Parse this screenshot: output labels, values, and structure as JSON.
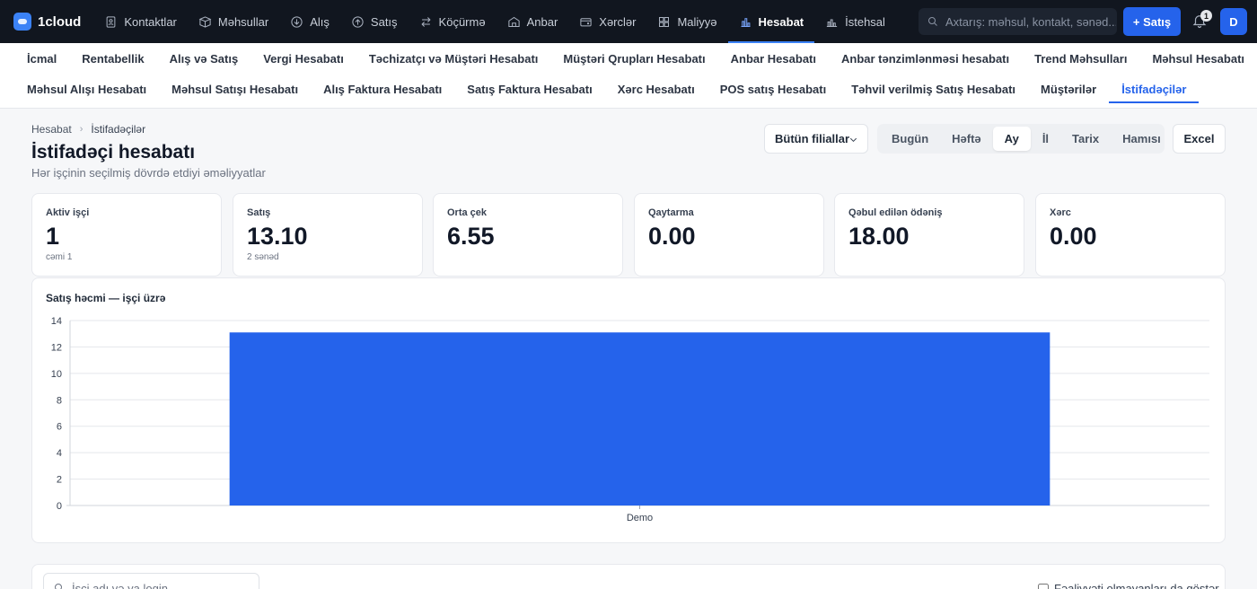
{
  "brand": {
    "name": "1cloud"
  },
  "topnav": [
    {
      "label": "Kontaktlar",
      "icon": "contacts-icon"
    },
    {
      "label": "Məhsullar",
      "icon": "box-icon"
    },
    {
      "label": "Alış",
      "icon": "arrow-down-circle-icon"
    },
    {
      "label": "Satış",
      "icon": "arrow-up-circle-icon"
    },
    {
      "label": "Köçürmə",
      "icon": "transfer-icon"
    },
    {
      "label": "Anbar",
      "icon": "warehouse-icon"
    },
    {
      "label": "Xərclər",
      "icon": "wallet-icon"
    },
    {
      "label": "Maliyyə",
      "icon": "grid-icon"
    },
    {
      "label": "Hesabat",
      "icon": "bar-chart-icon",
      "active": true
    },
    {
      "label": "İstehsal",
      "icon": "factory-icon"
    }
  ],
  "search": {
    "placeholder": "Axtarış: məhsul, kontakt, sənəd..."
  },
  "new_sale_label": "+ Satış",
  "notifications": {
    "count": "1"
  },
  "user": {
    "initial": "D"
  },
  "subnav_row1": [
    "İcmal",
    "Rentabellik",
    "Alış və Satış",
    "Vergi Hesabatı",
    "Təchizatçı və Müştəri Hesabatı",
    "Müştəri Qrupları Hesabatı",
    "Anbar Hesabatı",
    "Anbar tənzimlənməsi hesabatı",
    "Trend Məhsulları",
    "Məhsul Hesabatı"
  ],
  "subnav_row2": [
    "Məhsul Alışı Hesabatı",
    "Məhsul Satışı Hesabatı",
    "Alış Faktura Hesabatı",
    "Satış Faktura Hesabatı",
    "Xərc Hesabatı",
    "POS satış Hesabatı",
    "Təhvil verilmiş Satış Hesabatı",
    "Müştərilər",
    "İstifadəçilər"
  ],
  "subnav_active": "İstifadəçilər",
  "breadcrumb": {
    "root": "Hesabat",
    "current": "İstifadəçilər"
  },
  "page": {
    "title": "İstifadəçi hesabatı",
    "subtitle": "Hər işçinin seçilmiş dövrdə etdiyi əməliyyatlar"
  },
  "branch_filter": {
    "value": "Bütün filiallar"
  },
  "periods": [
    "Bugün",
    "Həftə",
    "Ay",
    "İl",
    "Tarix",
    "Hamısı"
  ],
  "period_active": "Ay",
  "excel_label": "Excel",
  "stats": [
    {
      "label": "Aktiv işçi",
      "value": "1",
      "sub": "cəmi 1"
    },
    {
      "label": "Satış",
      "value": "13.10",
      "sub": "2 sənəd"
    },
    {
      "label": "Orta çek",
      "value": "6.55",
      "sub": ""
    },
    {
      "label": "Qaytarma",
      "value": "0.00",
      "sub": ""
    },
    {
      "label": "Qəbul edilən ödəniş",
      "value": "18.00",
      "sub": ""
    },
    {
      "label": "Xərc",
      "value": "0.00",
      "sub": ""
    }
  ],
  "chart_data": {
    "type": "bar",
    "title": "Satış həcmi — işçi üzrə",
    "categories": [
      "Demo"
    ],
    "values": [
      13.1
    ],
    "ylim": [
      0,
      14
    ],
    "yticks": [
      0,
      2,
      4,
      6,
      8,
      10,
      12,
      14
    ],
    "grid": true,
    "color": "#2563eb"
  },
  "employee_search": {
    "placeholder": "İşçi adı və ya login..."
  },
  "inactive_toggle": {
    "label": "Fəaliyyəti olmayanları da göstər"
  }
}
